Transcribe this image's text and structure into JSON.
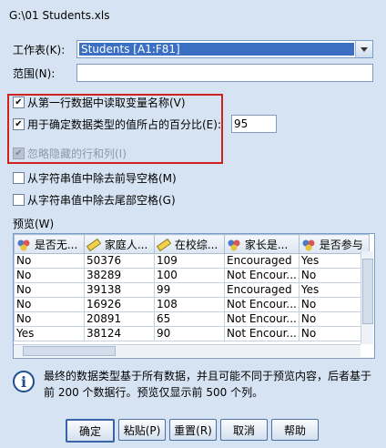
{
  "window": {
    "path": "G:\\01 Students.xls"
  },
  "worksheet": {
    "label": "工作表(K):",
    "value": "Students [A1:F81]"
  },
  "range": {
    "label": "范围(N):",
    "value": ""
  },
  "options": {
    "read_names": {
      "label": "从第一行数据中读取变量名称(V)",
      "checked": true
    },
    "pct_type": {
      "label": "用于确定数据类型的值所占的百分比(E):",
      "checked": true,
      "value": "95"
    },
    "ignore_hidden": {
      "label": "忽略隐藏的行和列(I)",
      "checked": true,
      "disabled": true
    },
    "trim_leading": {
      "label": "从字符串值中除去前导空格(M)",
      "checked": false
    },
    "trim_trailing": {
      "label": "从字符串值中除去尾部空格(G)",
      "checked": false
    }
  },
  "preview": {
    "label": "预览(W)",
    "columns": [
      "是否无...",
      "家庭人...",
      "在校综...",
      "家长是...",
      "是否参与"
    ],
    "column_icons": [
      "nominal-icon",
      "scale-icon",
      "scale-icon",
      "nominal-icon",
      "nominal-icon"
    ],
    "rows": [
      [
        "No",
        "50376",
        "109",
        "Encouraged",
        "Yes"
      ],
      [
        "No",
        "38289",
        "100",
        "Not Encour...",
        "No"
      ],
      [
        "No",
        "39138",
        "99",
        "Encouraged",
        "Yes"
      ],
      [
        "No",
        "16926",
        "108",
        "Not Encour...",
        "No"
      ],
      [
        "No",
        "20891",
        "65",
        "Not Encour...",
        "No"
      ],
      [
        "Yes",
        "38124",
        "90",
        "Not Encour...",
        "No"
      ]
    ]
  },
  "info": {
    "text": "最终的数据类型基于所有数据，并且可能不同于预览内容，后者基于前 200 个数据行。预览仅显示前 500 个列。"
  },
  "buttons": {
    "ok": "确定",
    "paste": "粘贴(P)",
    "reset": "重置(R)",
    "cancel": "取消",
    "help": "帮助"
  },
  "colors": {
    "accent": "#3a6fc4",
    "highlight_box": "#d02020",
    "background": "#d6e3f2"
  }
}
